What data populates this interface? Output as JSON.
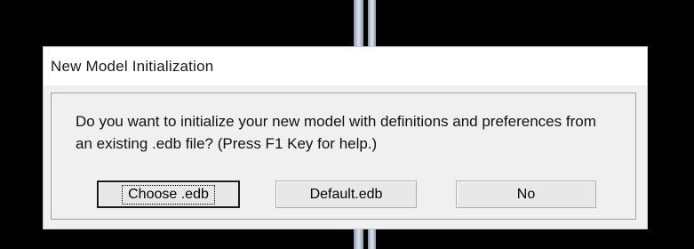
{
  "dialog": {
    "title": "New Model Initialization",
    "message": "Do you want to initialize your new model with definitions and preferences from an existing .edb file? (Press F1 Key for help.)",
    "buttons": {
      "choose_label": "Choose .edb",
      "default_label": "Default.edb",
      "no_label": "No"
    }
  }
}
